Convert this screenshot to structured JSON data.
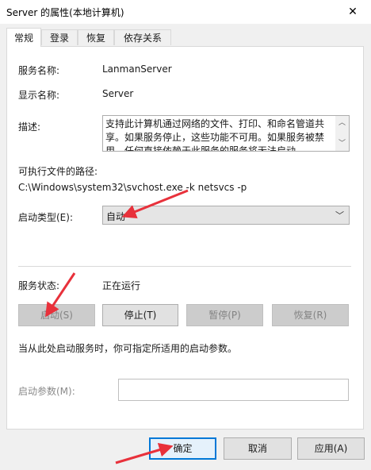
{
  "window": {
    "title": "Server 的属性(本地计算机)",
    "close_glyph": "✕"
  },
  "tabs": [
    {
      "label": "常规",
      "active": true
    },
    {
      "label": "登录",
      "active": false
    },
    {
      "label": "恢复",
      "active": false
    },
    {
      "label": "依存关系",
      "active": false
    }
  ],
  "general": {
    "service_name_label": "服务名称:",
    "service_name_value": "LanmanServer",
    "display_name_label": "显示名称:",
    "display_name_value": "Server",
    "description_label": "描述:",
    "description_value": "支持此计算机通过网络的文件、打印、和命名管道共享。如果服务停止，这些功能不可用。如果服务被禁用，任何直接依赖于此服务的服务将无法启动。",
    "exe_path_label": "可执行文件的路径:",
    "exe_path_value": "C:\\Windows\\system32\\svchost.exe -k netsvcs -p",
    "startup_type_label": "启动类型(E):",
    "startup_type_value": "自动",
    "status_label": "服务状态:",
    "status_value": "正在运行",
    "start_button": "启动(S)",
    "stop_button": "停止(T)",
    "pause_button": "暂停(P)",
    "resume_button": "恢复(R)",
    "hint_text": "当从此处启动服务时，你可指定所适用的启动参数。",
    "start_params_label": "启动参数(M):",
    "start_params_value": ""
  },
  "footer": {
    "ok_button": "确定",
    "cancel_button": "取消",
    "apply_button": "应用(A)"
  },
  "colors": {
    "annotation_arrow": "#e8313b",
    "focus_border": "#0078d7"
  }
}
